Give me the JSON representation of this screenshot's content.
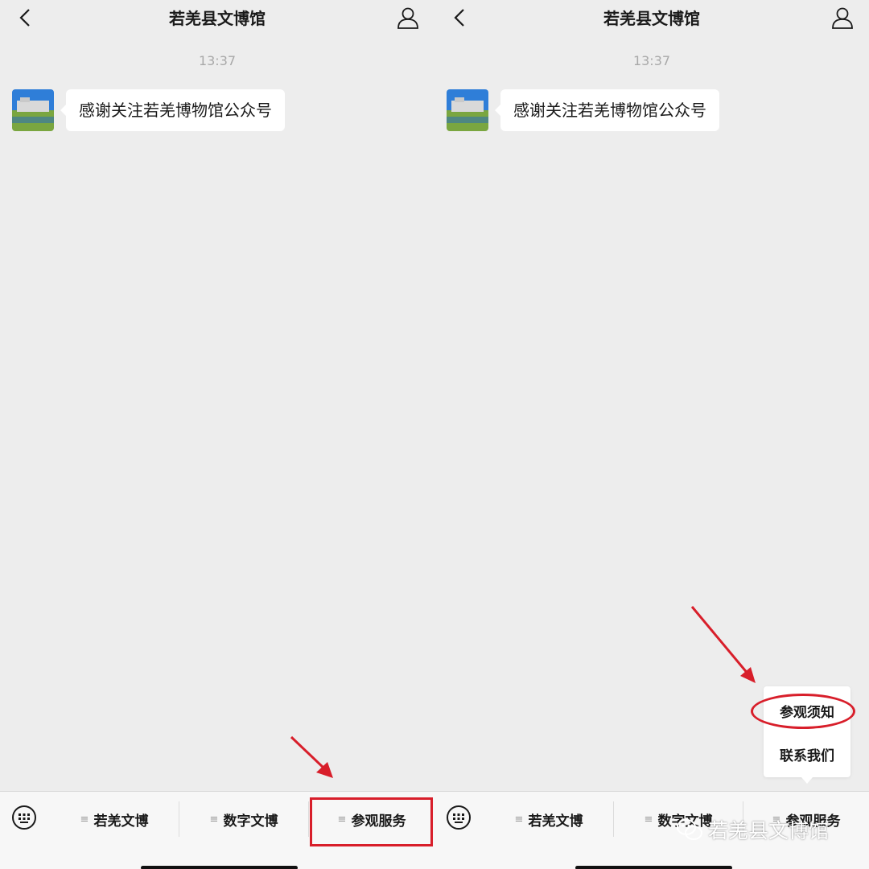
{
  "header": {
    "title": "若羌县文博馆"
  },
  "chat": {
    "timestamp": "13:37",
    "message": "感谢关注若羌博物馆公众号"
  },
  "menu": {
    "items": [
      {
        "label": "若羌文博"
      },
      {
        "label": "数字文博"
      },
      {
        "label": "参观服务"
      }
    ],
    "lines_glyph": "≡"
  },
  "submenu": {
    "items": [
      {
        "label": "参观须知"
      },
      {
        "label": "联系我们"
      }
    ]
  },
  "watermark": {
    "text": "若羌县文博馆"
  },
  "colors": {
    "annotation_red": "#d81e2a",
    "background": "#ededed"
  }
}
